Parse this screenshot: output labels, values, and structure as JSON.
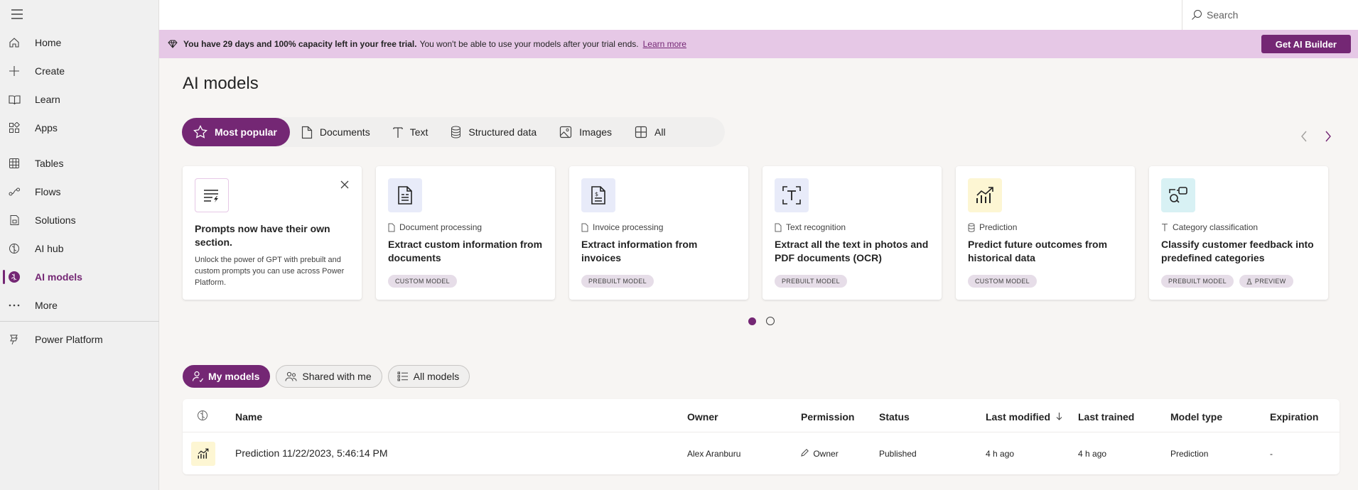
{
  "sidebar": {
    "items": [
      {
        "label": "Home"
      },
      {
        "label": "Create"
      },
      {
        "label": "Learn"
      },
      {
        "label": "Apps"
      },
      {
        "label": "Tables"
      },
      {
        "label": "Flows"
      },
      {
        "label": "Solutions"
      },
      {
        "label": "AI hub"
      },
      {
        "label": "AI models"
      },
      {
        "label": "More"
      },
      {
        "label": "Power Platform"
      }
    ],
    "active": "AI models"
  },
  "header": {
    "search_placeholder": "Search"
  },
  "banner": {
    "bold_text": "You have 29 days and 100% capacity left in your free trial.",
    "text": "You won't be able to use your models after your trial ends.",
    "link": "Learn more",
    "button": "Get AI Builder"
  },
  "page": {
    "title": "AI models"
  },
  "category_tabs": [
    {
      "label": "Most popular"
    },
    {
      "label": "Documents"
    },
    {
      "label": "Text"
    },
    {
      "label": "Structured data"
    },
    {
      "label": "Images"
    },
    {
      "label": "All"
    }
  ],
  "cards": {
    "prompt": {
      "title": "Prompts now have their own section.",
      "description": "Unlock the power of GPT with prebuilt and custom prompts you can use across Power Platform."
    },
    "models": [
      {
        "category": "Document processing",
        "title": "Extract custom information from documents",
        "badges": [
          "CUSTOM MODEL"
        ]
      },
      {
        "category": "Invoice processing",
        "title": "Extract information from invoices",
        "badges": [
          "PREBUILT MODEL"
        ]
      },
      {
        "category": "Text recognition",
        "title": "Extract all the text in photos and PDF documents (OCR)",
        "badges": [
          "PREBUILT MODEL"
        ]
      },
      {
        "category": "Prediction",
        "title": "Predict future outcomes from historical data",
        "badges": [
          "CUSTOM MODEL"
        ]
      },
      {
        "category": "Category classification",
        "title": "Classify customer feedback into predefined categories",
        "badges": [
          "PREBUILT MODEL",
          "PREVIEW"
        ]
      }
    ]
  },
  "carousel": {
    "pages": 2,
    "current": 1
  },
  "model_tabs": [
    {
      "label": "My models"
    },
    {
      "label": "Shared with me"
    },
    {
      "label": "All models"
    }
  ],
  "table": {
    "columns": {
      "name": "Name",
      "owner": "Owner",
      "permission": "Permission",
      "status": "Status",
      "last_modified": "Last modified",
      "last_trained": "Last trained",
      "model_type": "Model type",
      "expiration": "Expiration"
    },
    "rows": [
      {
        "name": "Prediction 11/22/2023, 5:46:14 PM",
        "owner": "Alex Aranburu",
        "permission": "Owner",
        "status": "Published",
        "last_modified": "4 h ago",
        "last_trained": "4 h ago",
        "model_type": "Prediction",
        "expiration": "-"
      }
    ]
  },
  "colors": {
    "accent": "#742774",
    "banner_bg": "#e6c8e6",
    "badge_bg": "#e6dde8"
  }
}
